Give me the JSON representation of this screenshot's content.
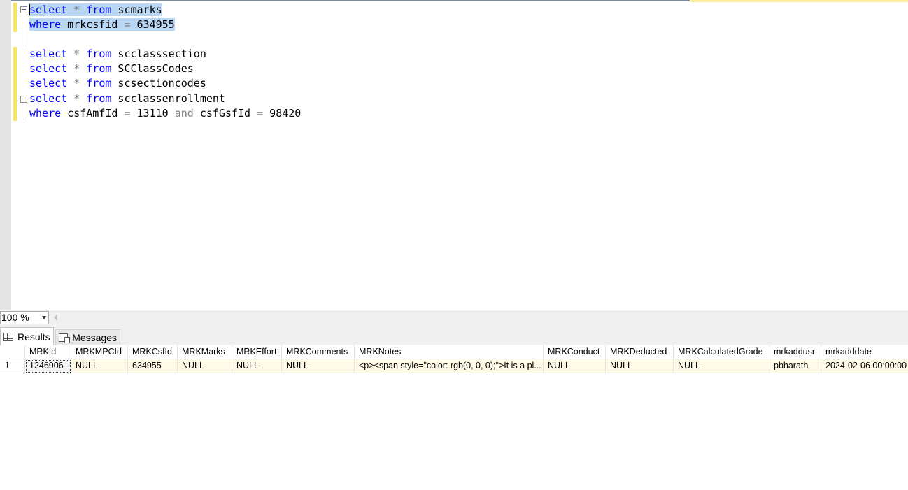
{
  "editor": {
    "lines": [
      [
        {
          "t": "kw",
          "v": "select"
        },
        {
          "t": "tx",
          "v": " "
        },
        {
          "t": "op",
          "v": "*"
        },
        {
          "t": "tx",
          "v": " "
        },
        {
          "t": "kw",
          "v": "from"
        },
        {
          "t": "tx",
          "v": " scmarks"
        }
      ],
      [
        {
          "t": "kw",
          "v": "where"
        },
        {
          "t": "tx",
          "v": " mrkcsfid "
        },
        {
          "t": "op",
          "v": "="
        },
        {
          "t": "tx",
          "v": " 634955"
        }
      ],
      [],
      [
        {
          "t": "kw",
          "v": "select"
        },
        {
          "t": "tx",
          "v": " "
        },
        {
          "t": "op",
          "v": "*"
        },
        {
          "t": "tx",
          "v": " "
        },
        {
          "t": "kw",
          "v": "from"
        },
        {
          "t": "tx",
          "v": " scclasssection"
        }
      ],
      [
        {
          "t": "kw",
          "v": "select"
        },
        {
          "t": "tx",
          "v": " "
        },
        {
          "t": "op",
          "v": "*"
        },
        {
          "t": "tx",
          "v": " "
        },
        {
          "t": "kw",
          "v": "from"
        },
        {
          "t": "tx",
          "v": " SCClassCodes"
        }
      ],
      [
        {
          "t": "kw",
          "v": "select"
        },
        {
          "t": "tx",
          "v": " "
        },
        {
          "t": "op",
          "v": "*"
        },
        {
          "t": "tx",
          "v": " "
        },
        {
          "t": "kw",
          "v": "from"
        },
        {
          "t": "tx",
          "v": " scsectioncodes"
        }
      ],
      [
        {
          "t": "kw",
          "v": "select"
        },
        {
          "t": "tx",
          "v": " "
        },
        {
          "t": "op",
          "v": "*"
        },
        {
          "t": "tx",
          "v": " "
        },
        {
          "t": "kw",
          "v": "from"
        },
        {
          "t": "tx",
          "v": " scclassenrollment"
        }
      ],
      [
        {
          "t": "kw",
          "v": "where"
        },
        {
          "t": "tx",
          "v": " csfAmfId "
        },
        {
          "t": "op",
          "v": "="
        },
        {
          "t": "tx",
          "v": " 13110 "
        },
        {
          "t": "op",
          "v": "and"
        },
        {
          "t": "tx",
          "v": " csfGsfId "
        },
        {
          "t": "op",
          "v": "="
        },
        {
          "t": "tx",
          "v": " 98420"
        }
      ]
    ],
    "selected_lines": [
      0,
      1
    ],
    "colors": {
      "keyword": "#0000ff",
      "operator": "#808080",
      "selection": "#b9d6f3",
      "change_bar": "#f6e65d"
    }
  },
  "zoom": {
    "value": "100 %"
  },
  "tabs": {
    "results": "Results",
    "messages": "Messages"
  },
  "grid": {
    "columns": [
      "MRKId",
      "MRKMPCId",
      "MRKCsfId",
      "MRKMarks",
      "MRKEffort",
      "MRKComments",
      "MRKNotes",
      "MRKConduct",
      "MRKDeducted",
      "MRKCalculatedGrade",
      "mrkaddusr",
      "mrkadddate"
    ],
    "rows": [
      {
        "num": "1",
        "cells": [
          "1246906",
          "NULL",
          "634955",
          "NULL",
          "NULL",
          "NULL",
          "<p><span style=\"color: rgb(0, 0, 0);\">It is a pl...",
          "NULL",
          "NULL",
          "NULL",
          "pbharath",
          "2024-02-06 00:00:00"
        ]
      }
    ]
  }
}
